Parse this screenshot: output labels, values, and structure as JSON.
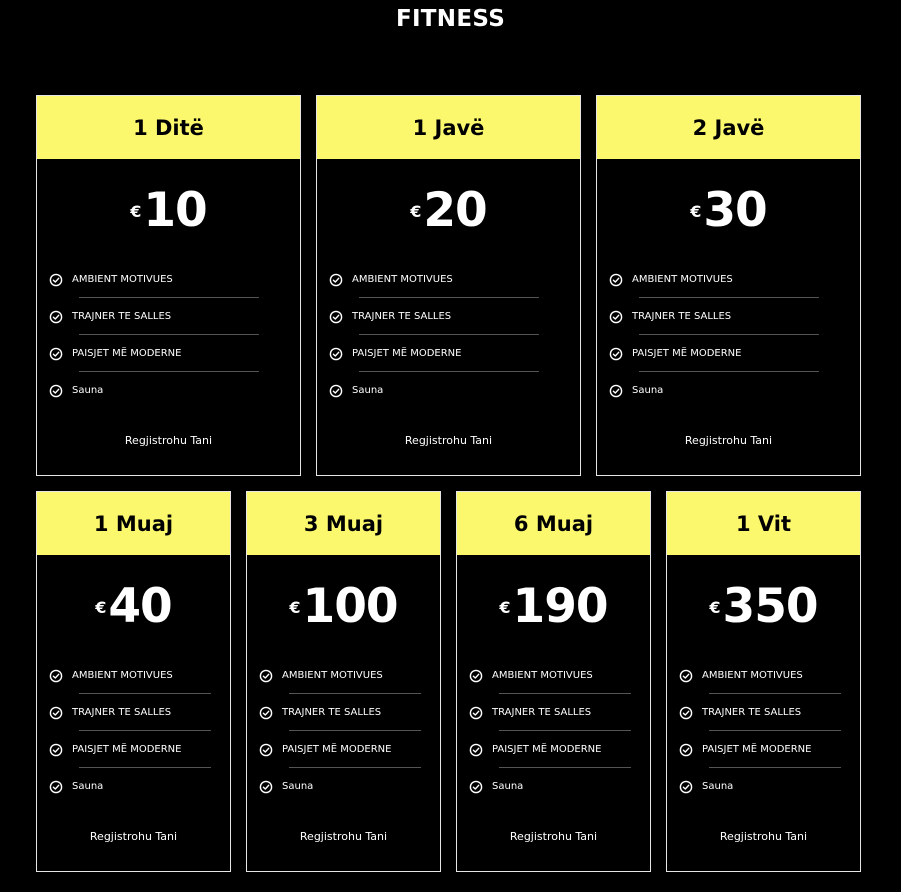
{
  "page": {
    "title": "FITNESS"
  },
  "colors": {
    "background": "#000000",
    "header": "#fbf86e",
    "text": "#ffffff",
    "border": "#e6e6e6"
  },
  "features": [
    "AMBIENT MOTIVUES",
    "TRAJNER TE SALLES",
    "PAISJET MË MODERNE",
    "Sauna"
  ],
  "cta_label": "Regjistrohu Tani",
  "plans": [
    {
      "name": "1 Ditë",
      "currency": "€",
      "price": "10"
    },
    {
      "name": "1 Javë",
      "currency": "€",
      "price": "20"
    },
    {
      "name": "2 Javë",
      "currency": "€",
      "price": "30"
    },
    {
      "name": "1 Muaj",
      "currency": "€",
      "price": "40"
    },
    {
      "name": "3 Muaj",
      "currency": "€",
      "price": "100"
    },
    {
      "name": "6 Muaj",
      "currency": "€",
      "price": "190"
    },
    {
      "name": "1 Vit",
      "currency": "€",
      "price": "350"
    }
  ]
}
